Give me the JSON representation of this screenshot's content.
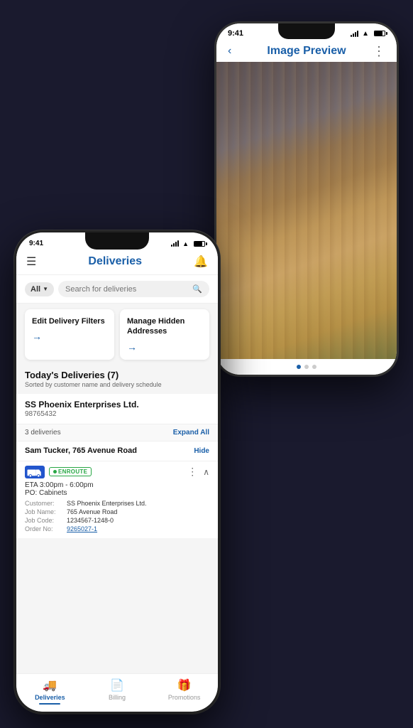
{
  "back_phone": {
    "time": "9:41",
    "title": "Image Preview",
    "dots": [
      true,
      false,
      false
    ]
  },
  "front_phone": {
    "time": "9:41",
    "header": {
      "title": "Deliveries"
    },
    "search": {
      "filter_label": "All",
      "placeholder": "Search for deliveries"
    },
    "action_cards": [
      {
        "title": "Edit Delivery Filters",
        "arrow": "→"
      },
      {
        "title": "Manage Hidden Addresses",
        "arrow": "→"
      }
    ],
    "deliveries_section": {
      "title": "Today's Deliveries (7)",
      "subtitle": "Sorted by customer name and delivery schedule"
    },
    "company": {
      "name": "SS Phoenix Enterprises Ltd.",
      "id": "98765432"
    },
    "delivery_group": {
      "count": "3 deliveries",
      "expand_label": "Expand All",
      "address": "Sam Tucker, 765 Avenue Road",
      "hide_label": "Hide",
      "status": "ENROUTE",
      "eta": "ETA 3:00pm - 6:00pm",
      "po": "PO: Cabinets",
      "details": [
        {
          "label": "Customer:",
          "value": "SS Phoenix Enterprises Ltd."
        },
        {
          "label": "Job Name:",
          "value": "765 Avenue Road"
        },
        {
          "label": "Job Code:",
          "value": "1234567-1248-0"
        },
        {
          "label": "Order No:",
          "value": "9265027-1",
          "link": true
        }
      ]
    },
    "bottom_nav": [
      {
        "icon": "🚚",
        "label": "Deliveries",
        "active": true
      },
      {
        "icon": "📄",
        "label": "Billing",
        "active": false
      },
      {
        "icon": "🎁",
        "label": "Promotions",
        "active": false
      }
    ]
  }
}
